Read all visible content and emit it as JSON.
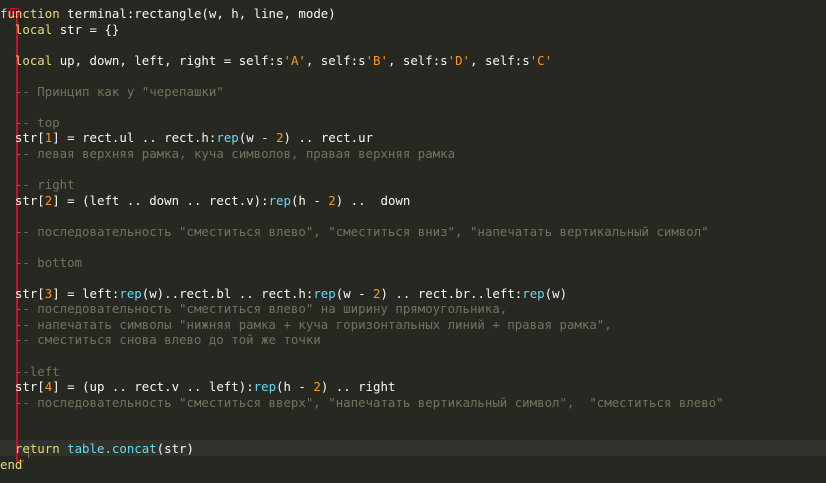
{
  "editor": {
    "lines": [
      [
        {
          "t": "function ",
          "c": "kw"
        },
        {
          "t": "terminal:rectangle(w, h, line, mode)",
          "c": "plain"
        }
      ],
      [
        {
          "t": "  local ",
          "c": "kw"
        },
        {
          "t": "str = {}",
          "c": "plain"
        }
      ],
      [],
      [
        {
          "t": "  local ",
          "c": "kw"
        },
        {
          "t": "up, down, left, right = self:s",
          "c": "plain"
        },
        {
          "t": "'A'",
          "c": "str"
        },
        {
          "t": ", self:s",
          "c": "plain"
        },
        {
          "t": "'B'",
          "c": "str"
        },
        {
          "t": ", self:s",
          "c": "plain"
        },
        {
          "t": "'D'",
          "c": "str"
        },
        {
          "t": ", self:s",
          "c": "plain"
        },
        {
          "t": "'C'",
          "c": "str"
        }
      ],
      [],
      [
        {
          "t": "  -- Принцип как у \"черепашки\"",
          "c": "cm"
        }
      ],
      [],
      [
        {
          "t": "  -- top",
          "c": "cm"
        }
      ],
      [
        {
          "t": "  str[",
          "c": "plain"
        },
        {
          "t": "1",
          "c": "num"
        },
        {
          "t": "] = rect.ul .. rect.h:",
          "c": "plain"
        },
        {
          "t": "rep",
          "c": "fn"
        },
        {
          "t": "(w - ",
          "c": "plain"
        },
        {
          "t": "2",
          "c": "num"
        },
        {
          "t": ") .. rect.ur",
          "c": "plain"
        }
      ],
      [
        {
          "t": "  -- левая верхняя рамка, куча символов, правая верхняя рамка",
          "c": "cm"
        }
      ],
      [],
      [
        {
          "t": "  -- right",
          "c": "cm"
        }
      ],
      [
        {
          "t": "  str[",
          "c": "plain"
        },
        {
          "t": "2",
          "c": "num"
        },
        {
          "t": "] = (left .. down .. rect.v):",
          "c": "plain"
        },
        {
          "t": "rep",
          "c": "fn"
        },
        {
          "t": "(h - ",
          "c": "plain"
        },
        {
          "t": "2",
          "c": "num"
        },
        {
          "t": ") ..  down",
          "c": "plain"
        }
      ],
      [],
      [
        {
          "t": "  -- последовательность \"сместиться влево\", \"сместиться вниз\", \"напечатать вертикальный символ\"",
          "c": "cm"
        }
      ],
      [],
      [
        {
          "t": "  -- bottom",
          "c": "cm"
        }
      ],
      [],
      [
        {
          "t": "  str[",
          "c": "plain"
        },
        {
          "t": "3",
          "c": "num"
        },
        {
          "t": "] = left:",
          "c": "plain"
        },
        {
          "t": "rep",
          "c": "fn"
        },
        {
          "t": "(w)..rect.bl .. rect.h:",
          "c": "plain"
        },
        {
          "t": "rep",
          "c": "fn"
        },
        {
          "t": "(w - ",
          "c": "plain"
        },
        {
          "t": "2",
          "c": "num"
        },
        {
          "t": ") .. rect.br..left:",
          "c": "plain"
        },
        {
          "t": "rep",
          "c": "fn"
        },
        {
          "t": "(w)",
          "c": "plain"
        }
      ],
      [
        {
          "t": "  -- последовательность \"сместиться влево\" на ширину прямоугольника,",
          "c": "cm"
        }
      ],
      [
        {
          "t": "  -- напечатать символы \"нижняя рамка + куча горизонтальных линий + правая рамка\",",
          "c": "cm"
        }
      ],
      [
        {
          "t": "  -- сместиться снова влево до той же точки",
          "c": "cm"
        }
      ],
      [],
      [
        {
          "t": "  --left",
          "c": "cm"
        }
      ],
      [
        {
          "t": "  str[",
          "c": "plain"
        },
        {
          "t": "4",
          "c": "num"
        },
        {
          "t": "] = (up .. rect.v .. left):",
          "c": "plain"
        },
        {
          "t": "rep",
          "c": "fn"
        },
        {
          "t": "(h - ",
          "c": "plain"
        },
        {
          "t": "2",
          "c": "num"
        },
        {
          "t": ") .. right",
          "c": "plain"
        }
      ],
      [
        {
          "t": "  -- последовательность \"сместиться вверх\", \"напечатать вертикальный символ\",  \"сместиться влево\"",
          "c": "cm"
        }
      ],
      [],
      [],
      [
        {
          "t": "  return ",
          "c": "kw"
        },
        {
          "t": "table.concat",
          "c": "fn"
        },
        {
          "t": "(str)",
          "c": "plain"
        }
      ],
      [
        {
          "t": "end",
          "c": "kw"
        }
      ]
    ]
  },
  "colors": {
    "background": "#272822",
    "keyword": "#e6db74",
    "string": "#fd971f",
    "number": "#fd971f",
    "function": "#66d9ef",
    "comment": "#75715e",
    "text": "#f8f8f2",
    "fold_marker": "#c8102e"
  },
  "fold_marker_icon": "minus-box-icon"
}
